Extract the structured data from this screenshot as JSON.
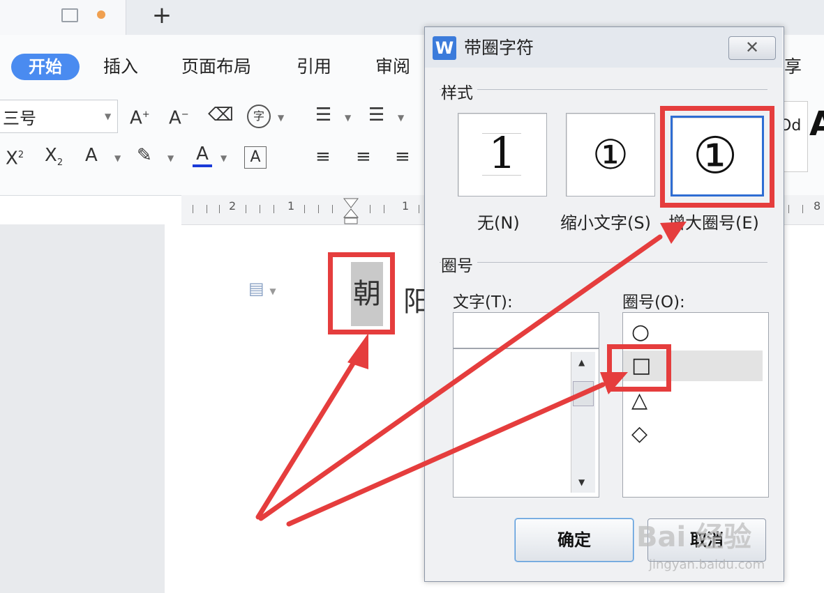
{
  "tabs": {
    "plus_label": "+"
  },
  "menu": {
    "items": [
      "开始",
      "插入",
      "页面布局",
      "引用",
      "审阅"
    ],
    "share_fragment": "享"
  },
  "toolbar": {
    "font_size": "三号",
    "icons": [
      "font-grow-icon",
      "font-shrink-icon",
      "clear-format-icon",
      "char-encircle-icon",
      "superscript-icon",
      "subscript-icon",
      "text-effect-icon",
      "highlight-icon",
      "font-color-icon",
      "char-border-icon",
      "bullets-icon",
      "numbering-icon",
      "align-left-icon",
      "align-center-icon",
      "align-right-icon"
    ]
  },
  "ruler": {
    "numbers": [
      "2",
      "1",
      "1",
      "8"
    ]
  },
  "document": {
    "char_selected": "朝",
    "char_next": "阳"
  },
  "dialog": {
    "title": "带圈字符",
    "close_glyph": "✕",
    "section_style": "样式",
    "styles": [
      {
        "label": "无(N)",
        "preview": "1"
      },
      {
        "label": "缩小文字(S)",
        "preview": "①"
      },
      {
        "label": "增大圈号(E)",
        "preview": "①"
      }
    ],
    "section_enclosure": "圈号",
    "text_label": "文字(T):",
    "enclosure_label": "圈号(O):",
    "enclosures": [
      "○",
      "□",
      "△",
      "◇"
    ],
    "ok_label": "确定",
    "cancel_label": "取消"
  },
  "colors": {
    "accent": "#4a8bf0",
    "highlight_red": "#e53d3d",
    "selection_blue": "#2e6dd3"
  },
  "watermark": {
    "brand": "Bai 经验",
    "url": "jingyan.baidu.com"
  }
}
